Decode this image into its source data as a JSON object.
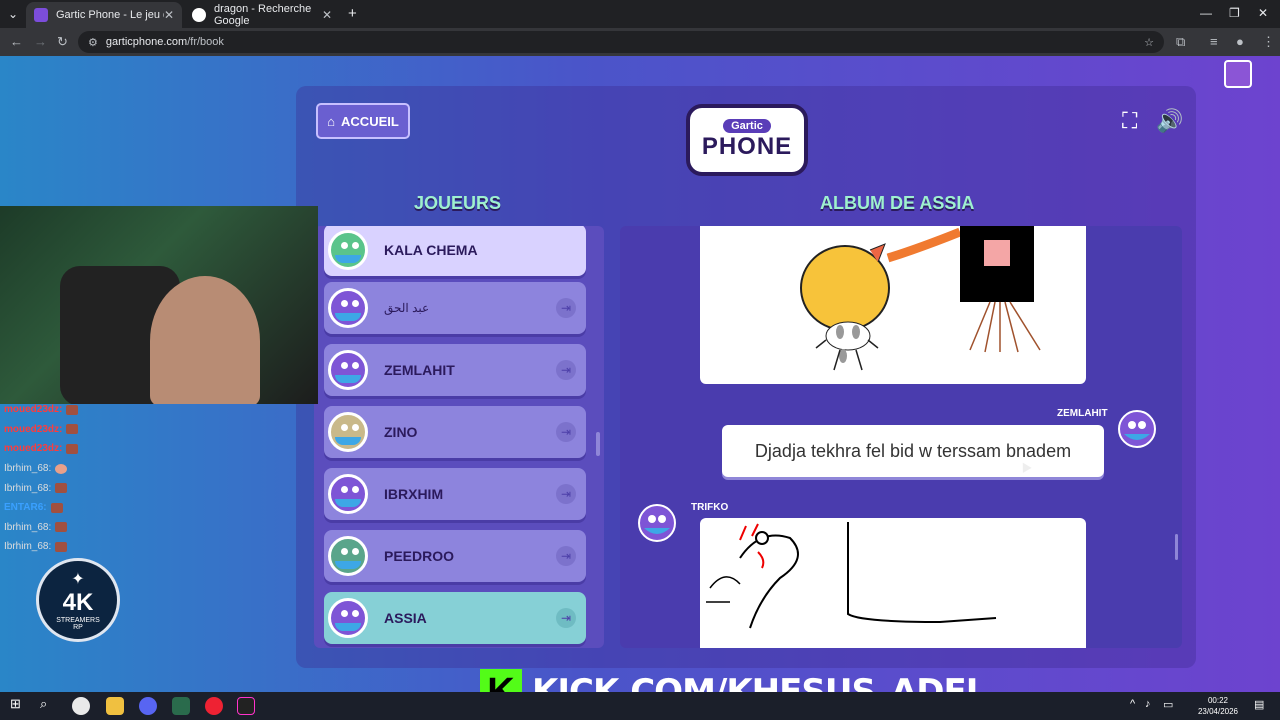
{
  "browser": {
    "tabs": [
      {
        "title": "Gartic Phone - Le jeu du téléph",
        "active": true,
        "favicon_color": "#7c4ddb"
      },
      {
        "title": "dragon - Recherche Google",
        "active": false,
        "favicon_color": "#ffffff"
      }
    ],
    "new_tab_label": "+",
    "url_domain": "garticphone.com",
    "url_path": "/fr/book"
  },
  "game": {
    "home_button": "ACCUEIL",
    "logo_top": "Gartic",
    "logo_bottom": "PHONE",
    "players_title": "JOUEURS",
    "album_title": "ALBUM DE ASSIA",
    "players": [
      {
        "name": "KALA CHEMA",
        "state": "me"
      },
      {
        "name": "عبد الحق",
        "state": "normal"
      },
      {
        "name": "ZEMLAHIT",
        "state": "normal"
      },
      {
        "name": "ZINO",
        "state": "normal"
      },
      {
        "name": "IBRXHIM",
        "state": "normal"
      },
      {
        "name": "PEEDROO",
        "state": "normal"
      },
      {
        "name": "ASSIA",
        "state": "current"
      }
    ],
    "album": {
      "message_author": "ZEMLAHIT",
      "message_text": "Djadja tekhra fel bid w terssam bnadem",
      "drawing_author": "TRIFKO"
    }
  },
  "overlay": {
    "kick_letter": "K",
    "kick_text": "KICK.COM/KHESUS_ADEL",
    "badge_main": "4K",
    "badge_sub": "STREAMERS",
    "badge_sub2": "RP",
    "chat": [
      {
        "user": "moued23dz:",
        "color": "#ff3b3b"
      },
      {
        "user": "moued23dz:",
        "color": "#ff3b3b"
      },
      {
        "user": "moued23dz:",
        "color": "#ff3b3b"
      },
      {
        "user": "Ibrhim_68:",
        "color": "#dddddd"
      },
      {
        "user": "Ibrhim_68:",
        "color": "#dddddd"
      },
      {
        "user": "ENTAR6:",
        "color": "#3aa0ff"
      },
      {
        "user": "Ibrhim_68:",
        "color": "#dddddd"
      },
      {
        "user": "Ibrhim_68:",
        "color": "#dddddd"
      }
    ]
  },
  "taskbar": {
    "time": "00:22",
    "date": "23/04/2026"
  }
}
